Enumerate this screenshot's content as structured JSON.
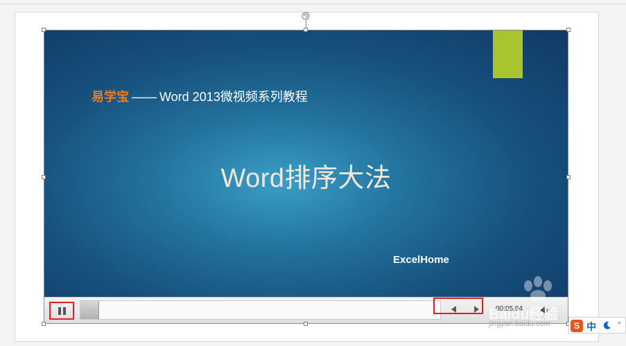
{
  "slide": {
    "brand": "易学宝",
    "dash": "——",
    "subtitle": "Word 2013微视频系列教程",
    "title": "Word排序大法",
    "credit": "ExcelHome"
  },
  "player": {
    "time": "00:05.94",
    "progress": 0.0
  },
  "watermark": {
    "text": "Baidu经验",
    "url": "jingyan.baidu.com"
  },
  "ime": {
    "logo": "S",
    "mode": "中",
    "dot": "°"
  },
  "colors": {
    "brand_orange": "#f07c1b",
    "accent_green": "#a8c52f",
    "highlight_red": "#e02020"
  },
  "icons": [
    "pause-icon",
    "previous-frame-icon",
    "next-frame-icon",
    "volume-icon",
    "rotate-handle-icon",
    "moon-icon"
  ]
}
